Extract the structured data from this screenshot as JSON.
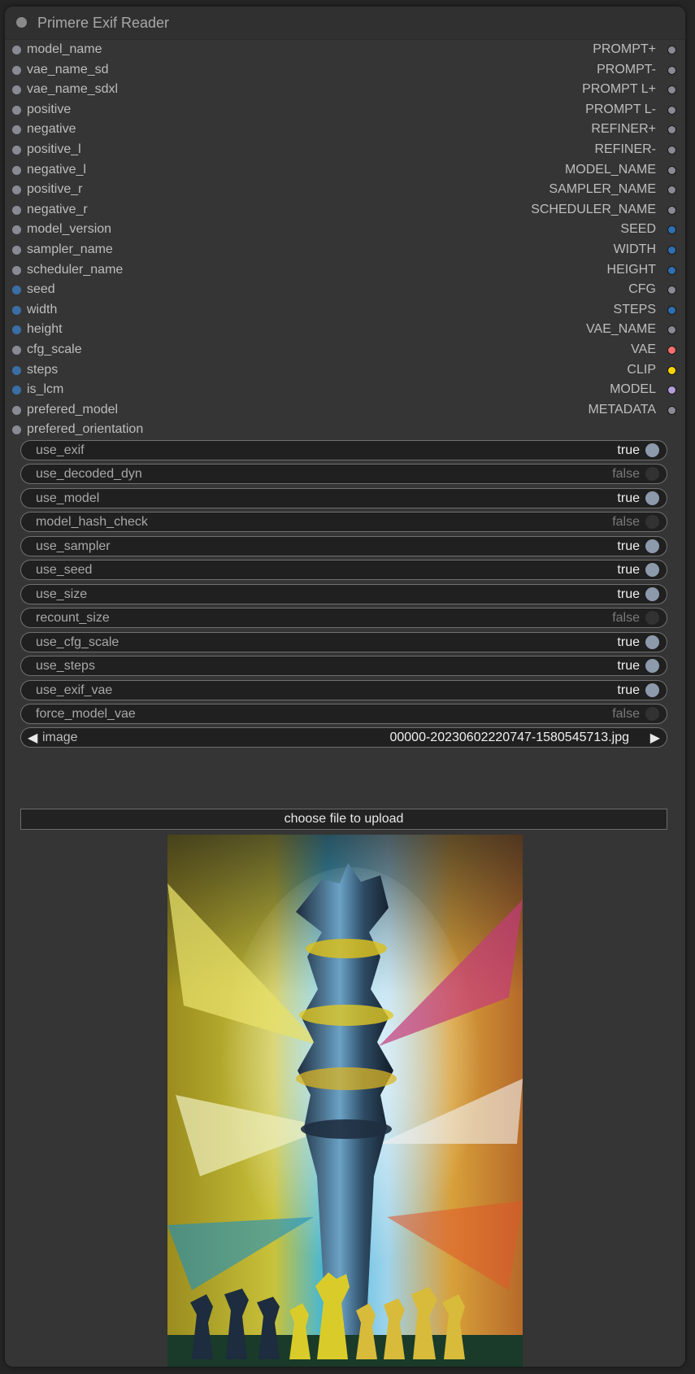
{
  "node": {
    "title": "Primere Exif Reader"
  },
  "inputs": [
    {
      "label": "model_name",
      "color": "#8a8a94"
    },
    {
      "label": "vae_name_sd",
      "color": "#8a8a94"
    },
    {
      "label": "vae_name_sdxl",
      "color": "#8a8a94"
    },
    {
      "label": "positive",
      "color": "#8a8a94"
    },
    {
      "label": "negative",
      "color": "#8a8a94"
    },
    {
      "label": "positive_l",
      "color": "#8a8a94"
    },
    {
      "label": "negative_l",
      "color": "#8a8a94"
    },
    {
      "label": "positive_r",
      "color": "#8a8a94"
    },
    {
      "label": "negative_r",
      "color": "#8a8a94"
    },
    {
      "label": "model_version",
      "color": "#8a8a94"
    },
    {
      "label": "sampler_name",
      "color": "#8a8a94"
    },
    {
      "label": "scheduler_name",
      "color": "#8a8a94"
    },
    {
      "label": "seed",
      "color": "#3a6ea5"
    },
    {
      "label": "width",
      "color": "#3a6ea5"
    },
    {
      "label": "height",
      "color": "#3a6ea5"
    },
    {
      "label": "cfg_scale",
      "color": "#8a8a94"
    },
    {
      "label": "steps",
      "color": "#3a6ea5"
    },
    {
      "label": "is_lcm",
      "color": "#3a6ea5"
    },
    {
      "label": "prefered_model",
      "color": "#8a8a94"
    },
    {
      "label": "prefered_orientation",
      "color": "#8a8a94"
    }
  ],
  "outputs": [
    {
      "label": "PROMPT+",
      "color": "#8a8a94"
    },
    {
      "label": "PROMPT-",
      "color": "#8a8a94"
    },
    {
      "label": "PROMPT L+",
      "color": "#8a8a94"
    },
    {
      "label": "PROMPT L-",
      "color": "#8a8a94"
    },
    {
      "label": "REFINER+",
      "color": "#8a8a94"
    },
    {
      "label": "REFINER-",
      "color": "#8a8a94"
    },
    {
      "label": "MODEL_NAME",
      "color": "#8a8a94"
    },
    {
      "label": "SAMPLER_NAME",
      "color": "#8a8a94"
    },
    {
      "label": "SCHEDULER_NAME",
      "color": "#8a8a94"
    },
    {
      "label": "SEED",
      "color": "#2f6fb3"
    },
    {
      "label": "WIDTH",
      "color": "#2f6fb3"
    },
    {
      "label": "HEIGHT",
      "color": "#2f6fb3"
    },
    {
      "label": "CFG",
      "color": "#8a8a94"
    },
    {
      "label": "STEPS",
      "color": "#2f6fb3"
    },
    {
      "label": "VAE_NAME",
      "color": "#8a8a94"
    },
    {
      "label": "VAE",
      "color": "#ff6e6e"
    },
    {
      "label": "CLIP",
      "color": "#ffd500"
    },
    {
      "label": "MODEL",
      "color": "#b39ddb"
    },
    {
      "label": "METADATA",
      "color": "#8a8a94"
    }
  ],
  "toggles": [
    {
      "label": "use_exif",
      "value": "true",
      "on": true
    },
    {
      "label": "use_decoded_dyn",
      "value": "false",
      "on": false
    },
    {
      "label": "use_model",
      "value": "true",
      "on": true
    },
    {
      "label": "model_hash_check",
      "value": "false",
      "on": false
    },
    {
      "label": "use_sampler",
      "value": "true",
      "on": true
    },
    {
      "label": "use_seed",
      "value": "true",
      "on": true
    },
    {
      "label": "use_size",
      "value": "true",
      "on": true
    },
    {
      "label": "recount_size",
      "value": "false",
      "on": false
    },
    {
      "label": "use_cfg_scale",
      "value": "true",
      "on": true
    },
    {
      "label": "use_steps",
      "value": "true",
      "on": true
    },
    {
      "label": "use_exif_vae",
      "value": "true",
      "on": true
    },
    {
      "label": "force_model_vae",
      "value": "false",
      "on": false
    }
  ],
  "image_combo": {
    "label": "image",
    "value": "00000-20230602220747-1580545713.jpg",
    "left_arrow": "◀",
    "right_arrow": "▶"
  },
  "upload": {
    "label": "choose file to upload"
  },
  "icons": {
    "collapse": "collapse-dot-icon",
    "input_slot": "slot-dot-icon",
    "output_slot": "slot-dot-icon"
  }
}
